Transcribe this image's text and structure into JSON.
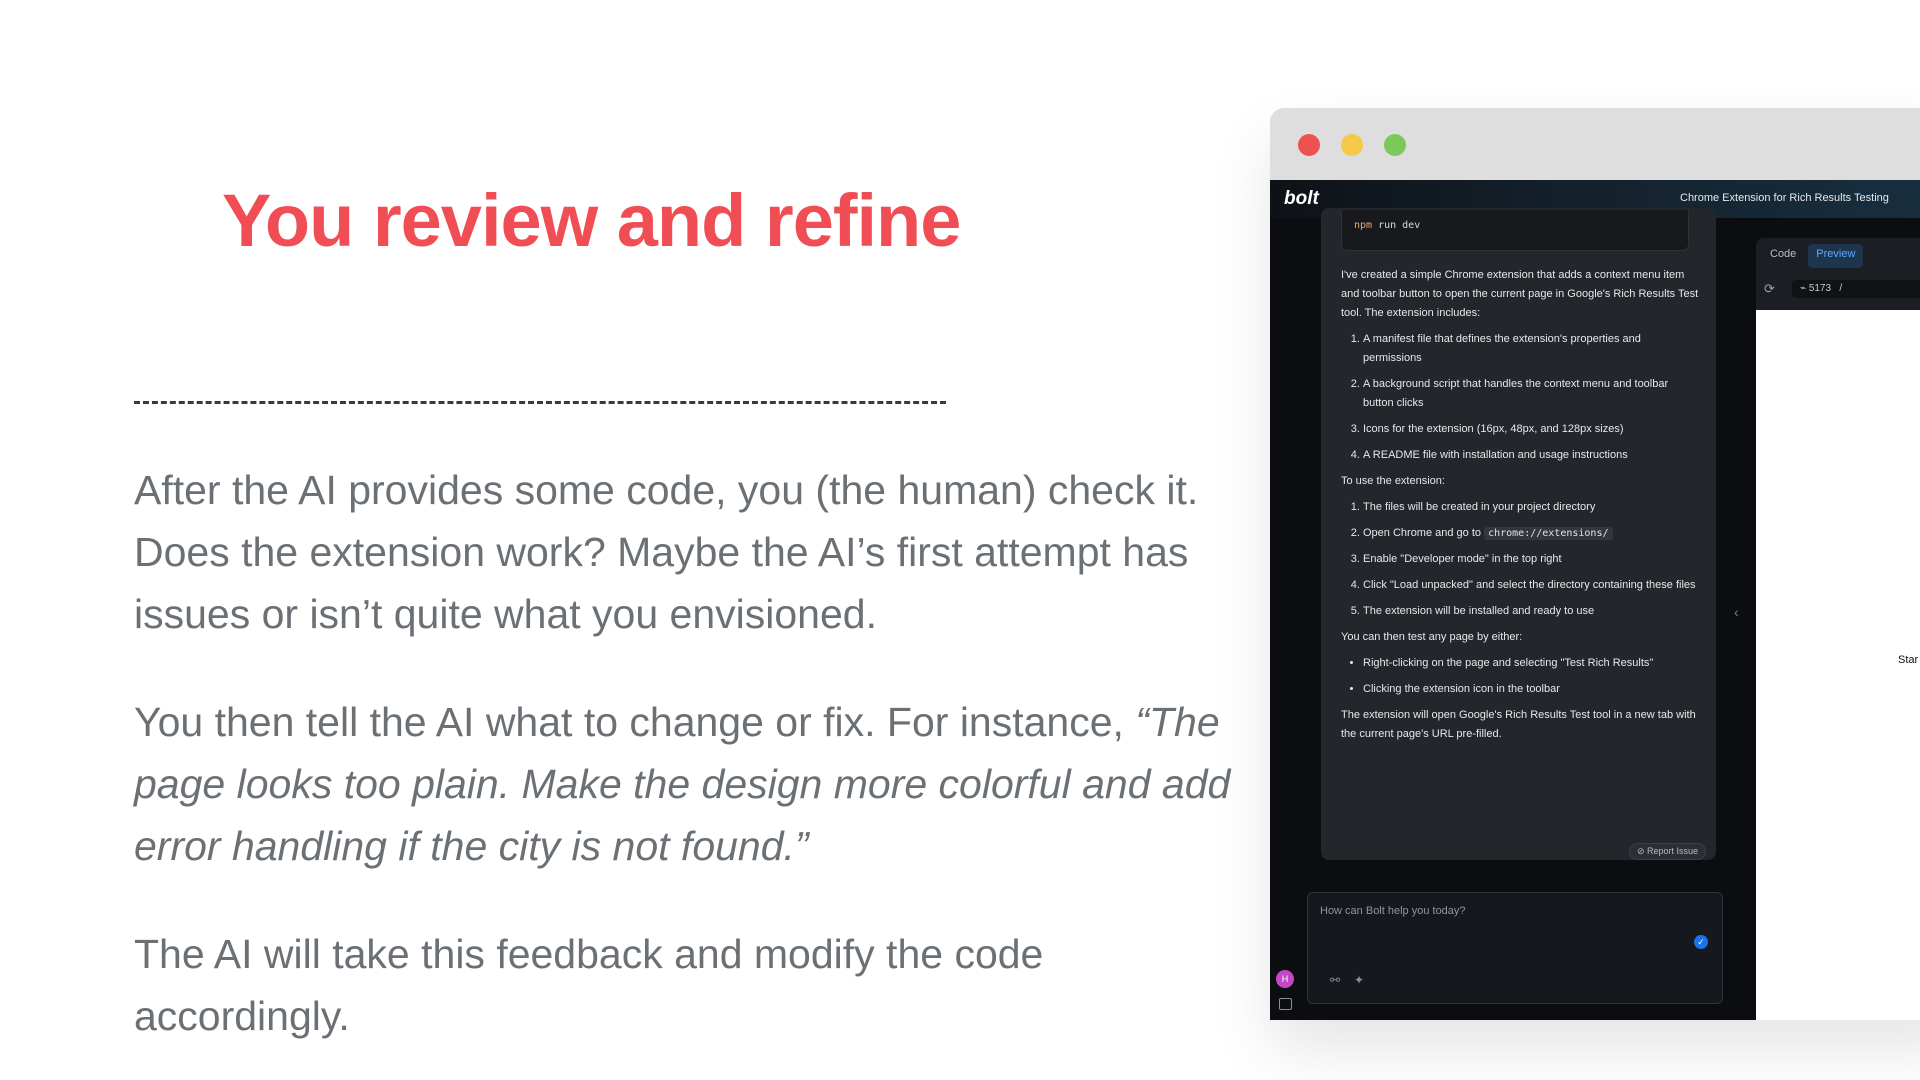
{
  "slide": {
    "title": "You review and refine",
    "paragraph1": "After the AI provides some code, you (the human) check it. Does the extension work? Maybe the AI’s first attempt has issues or isn’t quite what you envisioned.",
    "paragraph2_lead": "You then tell the AI what to change or fix. For instance, ",
    "paragraph2_quote": "“The page looks too plain. Make the design more colorful and add error handling if the city is not found.”",
    "paragraph3": "The AI will take this feedback and modify the code accordingly.",
    "accent_color": "#f04e54"
  },
  "app": {
    "logo": "bolt",
    "project_title": "Chrome Extension for Rich Results Testing",
    "code_prefix": "npm",
    "code_rest": " run dev",
    "intro": "I've created a simple Chrome extension that adds a context menu item and toolbar button to open the current page in Google's Rich Results Test tool. The extension includes:",
    "includes": [
      "A manifest file that defines the extension's properties and permissions",
      "A background script that handles the context menu and toolbar button clicks",
      "Icons for the extension (16px, 48px, and 128px sizes)",
      "A README file with installation and usage instructions"
    ],
    "use_heading": "To use the extension:",
    "steps": {
      "s1": "The files will be created in your project directory",
      "s2_pre": "Open Chrome and go to ",
      "s2_code": "chrome://extensions/",
      "s3": "Enable \"Developer mode\" in the top right",
      "s4": "Click \"Load unpacked\" and select the directory containing these files",
      "s5": "The extension will be installed and ready to use"
    },
    "test_heading": "You can then test any page by either:",
    "test_methods": [
      "Right-clicking on the page and selecting \"Test Rich Results\"",
      "Clicking the extension icon in the toolbar"
    ],
    "closing": "The extension will open Google's Rich Results Test tool in a new tab with the current page's URL pre-filled.",
    "report_issue": "⊘ Report Issue",
    "input_placeholder": "How can Bolt help you today?",
    "avatar_initial": "H",
    "tabs": [
      "Code",
      "Preview"
    ],
    "active_tab": "Preview",
    "port": "5173",
    "path": "/",
    "preview_text": "Star"
  }
}
